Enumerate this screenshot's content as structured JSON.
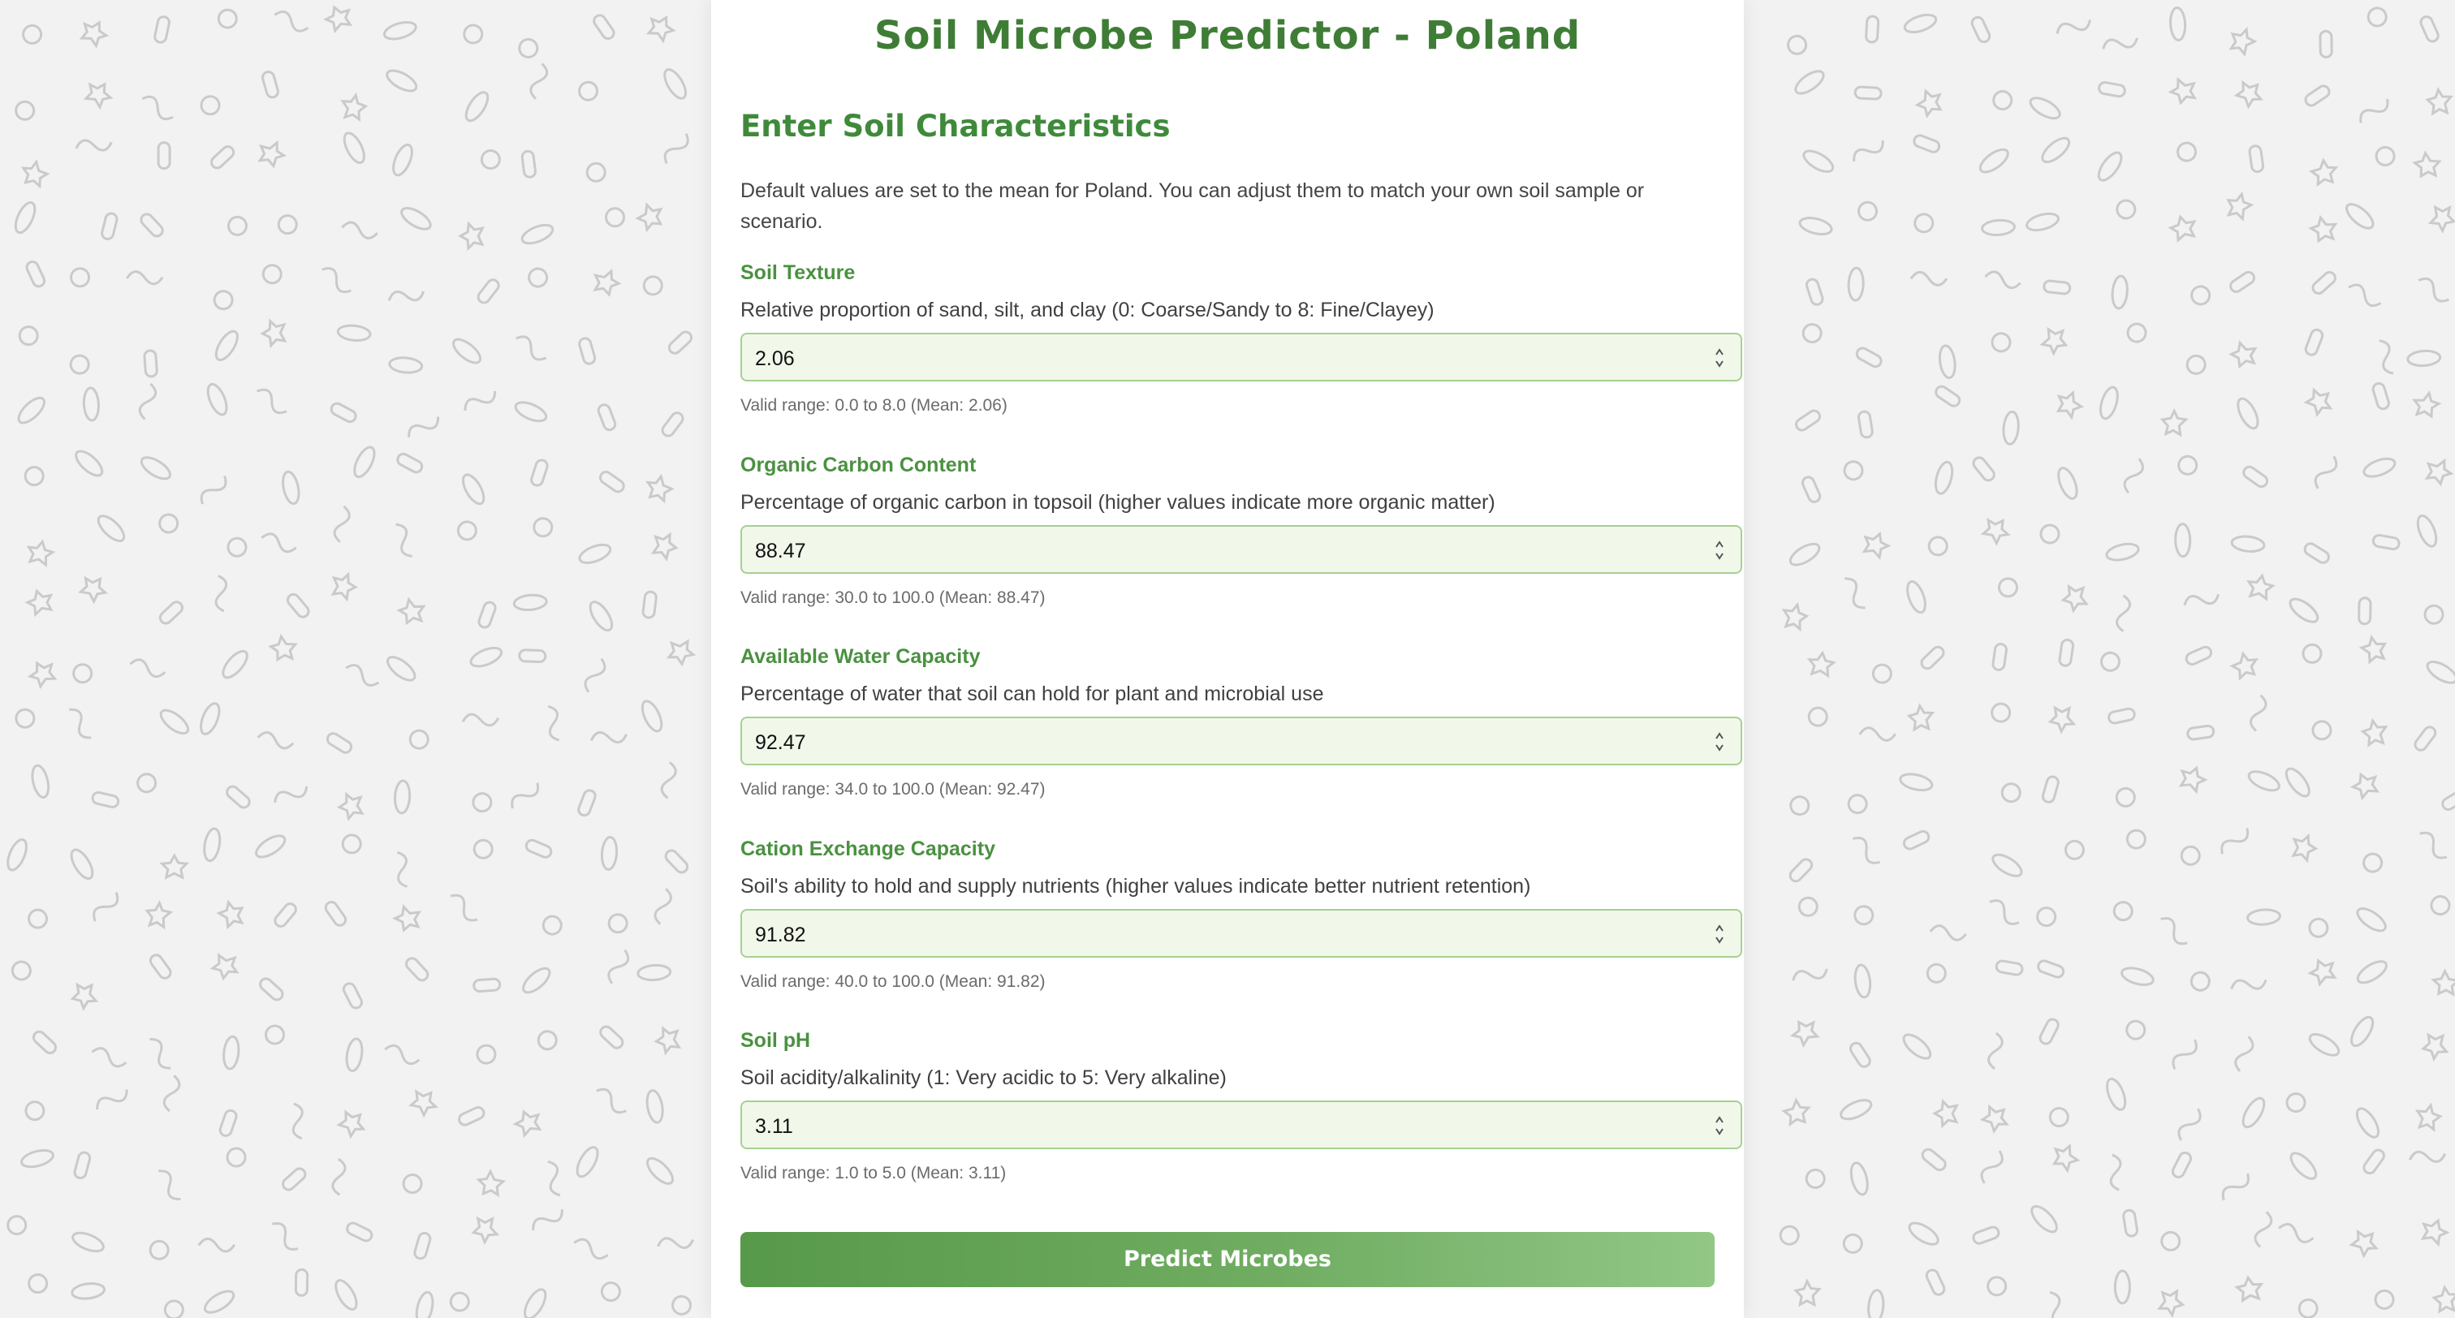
{
  "app": {
    "title": "Soil Microbe Predictor - Poland"
  },
  "form": {
    "heading": "Enter Soil Characteristics",
    "intro": "Default values are set to the mean for Poland. You can adjust them to match your own soil sample or scenario.",
    "fields": [
      {
        "label": "Soil Texture",
        "description": "Relative proportion of sand, silt, and clay (0: Coarse/Sandy to 8: Fine/Clayey)",
        "value": "2.06",
        "hint": "Valid range: 0.0 to 8.0 (Mean: 2.06)"
      },
      {
        "label": "Organic Carbon Content",
        "description": "Percentage of organic carbon in topsoil (higher values indicate more organic matter)",
        "value": "88.47",
        "hint": "Valid range: 30.0 to 100.0 (Mean: 88.47)"
      },
      {
        "label": "Available Water Capacity",
        "description": "Percentage of water that soil can hold for plant and microbial use",
        "value": "92.47",
        "hint": "Valid range: 34.0 to 100.0 (Mean: 92.47)"
      },
      {
        "label": "Cation Exchange Capacity",
        "description": "Soil's ability to hold and supply nutrients (higher values indicate better nutrient retention)",
        "value": "91.82",
        "hint": "Valid range: 40.0 to 100.0 (Mean: 91.82)"
      },
      {
        "label": "Soil pH",
        "description": "Soil acidity/alkalinity (1: Very acidic to 5: Very alkaline)",
        "value": "3.11",
        "hint": "Valid range: 1.0 to 5.0 (Mean: 3.11)"
      }
    ],
    "submit_label": "Predict Microbes"
  },
  "background": {
    "pattern": "microbe-doodle-pattern"
  },
  "colors": {
    "accent": "#3f7d36",
    "label": "#4a9140",
    "input_bg": "#f1f8ea",
    "input_border": "#a6d092",
    "button_start": "#57994a",
    "button_end": "#92c786"
  }
}
